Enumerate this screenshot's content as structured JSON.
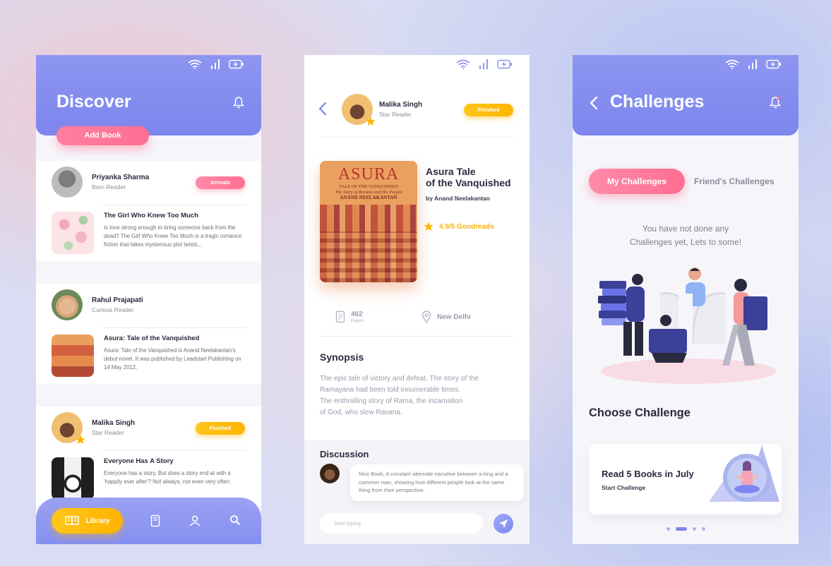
{
  "discover": {
    "title": "Discover",
    "add_book_label": "Add Book",
    "posts": [
      {
        "user": {
          "name": "Priyanka Sharma",
          "role": "Born Reader"
        },
        "badge": "Arrivals",
        "book": {
          "title": "The Girl Who Knew Too Much",
          "desc": "Is love strong enough to bring someone back from the dead? The Girl Who Knew Too Much is a tragic romance fiction that takes mysterious plot twists..."
        }
      },
      {
        "user": {
          "name": "Rahul Prajapati",
          "role": "Curious Reader"
        },
        "badge": "",
        "book": {
          "title": "Asura: Tale of the Vanquished",
          "desc": "Asura: Tale of the Vanquished is Anand Neelakantan's debut novel. It was published by Leadstart Publishing on 14 May 2012."
        }
      },
      {
        "user": {
          "name": "Malika Singh",
          "role": "Star Reader"
        },
        "badge": "Finished",
        "book": {
          "title": "Everyone Has A Story",
          "desc": "Everyone has a story. But does a story end at with a 'happily ever after'? Not always, not even very often."
        }
      }
    ],
    "nav": {
      "library_label": "Library"
    }
  },
  "detail": {
    "user": {
      "name": "Malika Singh",
      "role": "Star Reader"
    },
    "badge": "Finished",
    "cover": {
      "title": "ASURA",
      "subtitle1": "TALE OF THE VANQUISHED",
      "subtitle2": "The Story of Ravana and His People",
      "author": "ANAND NEELAKANTAN"
    },
    "book": {
      "title_line1": "Asura Tale",
      "title_line2": "of the Vanquished",
      "author": "by Anand Neelakantan",
      "rating": "4.9/5 Goodreads"
    },
    "pages_value": "462",
    "pages_label": "Pages",
    "location": "New Delhi",
    "synopsis_title": "Synopsis",
    "synopsis_text": "The epic tale of victory and defeat. The story of the\nRamayana had been told innumerable times.\nThe enthralling story of Rama, the incarnation\n of God, who slew Ravana.",
    "discussion_title": "Discussion",
    "comment": "Nice Book, A constant alternate narrative between a king and a common man, showing how different people look at the same thing from their perspective.",
    "input_placeholder": "Start typing..."
  },
  "challenges": {
    "title": "Challenges",
    "tab_mine": "My Challenges",
    "tab_friends": "Friend's Challenges",
    "empty_message": "You have not done any\nChallenges yet, Lets to some!",
    "choose_title": "Choose Challenge",
    "card_title": "Read 5 Books in July",
    "card_sub": "Start Challenge",
    "pagination": {
      "count": 4,
      "active": 1
    }
  },
  "colors": {
    "primary": "#7c86ee",
    "pink": "#ff6f92",
    "yellow": "#ffb400",
    "text_dark": "#2a2a3f",
    "text_muted": "#8b8b9c"
  },
  "icons": [
    "wifi-icon",
    "signal-icon",
    "battery-icon",
    "bell-icon",
    "back-icon",
    "star-icon",
    "pages-icon",
    "location-icon",
    "send-icon",
    "library-icon",
    "book-icon",
    "user-icon",
    "search-icon"
  ]
}
